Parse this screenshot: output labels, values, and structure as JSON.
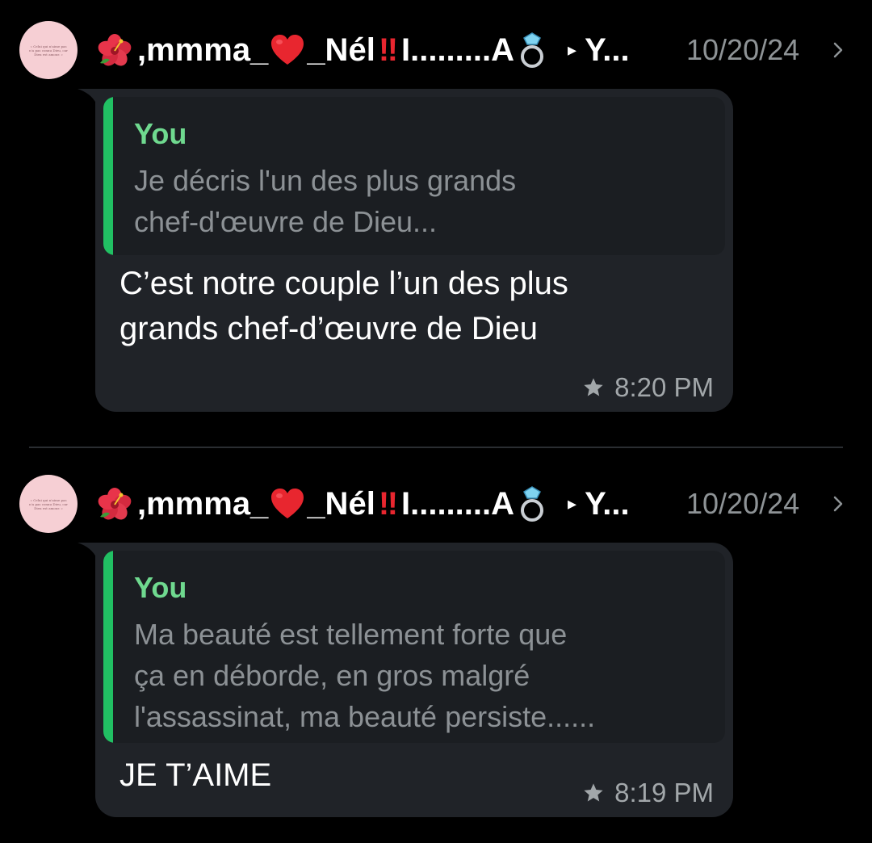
{
  "entries": [
    {
      "avatar_text": "« Celui qui n'aime pas n'a pas connu Dieu, car Dieu est amour. »",
      "sender_prefix": ",mmma_",
      "sender_mid": "_Nél",
      "sender_suffix": "I.........A",
      "recipient": "Y...",
      "date": "10/20/24",
      "quote_author": "You",
      "quote_text": "Je décris l'un des plus grands\nchef-d'œuvre de Dieu...",
      "message": "C’est notre couple l’un des plus\ngrands chef-d’œuvre de Dieu",
      "time": "8:20 PM"
    },
    {
      "avatar_text": "« Celui qui n'aime pas n'a pas connu Dieu, car Dieu est amour. »",
      "sender_prefix": ",mmma_",
      "sender_mid": "_Nél",
      "sender_suffix": "I.........A",
      "recipient": "Y...",
      "date": "10/20/24",
      "quote_author": "You",
      "quote_text": "Ma beauté est tellement forte que\nça en déborde, en gros malgré\nl'assassinat, ma beauté persiste......",
      "message": "JE T’AIME",
      "time": "8:19 PM"
    }
  ],
  "glyphs": {
    "bangbang": "‼",
    "arrow": "▸"
  },
  "icons": [
    "hibiscus-icon",
    "red-heart-icon",
    "double-exclamation-icon",
    "ring-icon",
    "play-arrow-icon",
    "chevron-right-icon",
    "star-icon"
  ],
  "colors": {
    "background": "#000000",
    "bubble": "#202328",
    "quote_background": "#1b1e22",
    "quote_bar": "#21c063",
    "quote_author": "#6fd98f",
    "quote_text": "#8c9195",
    "meta_text": "#a2a7aa",
    "divider": "#2a2d31"
  }
}
